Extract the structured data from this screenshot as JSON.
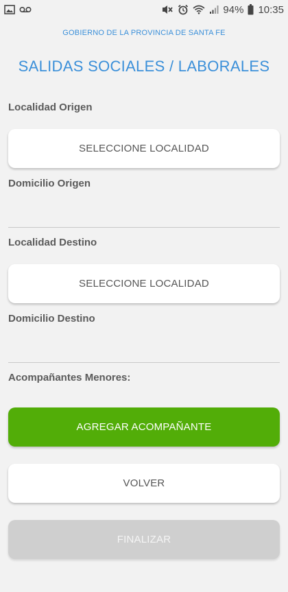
{
  "status_bar": {
    "battery_percent": "94%",
    "time": "10:35",
    "icons": [
      "image-icon",
      "voicemail-icon",
      "mute-icon",
      "alarm-icon",
      "wifi-icon",
      "signal-icon",
      "battery-icon"
    ]
  },
  "header": {
    "government": "GOBIERNO DE LA PROVINCIA DE SANTA FE",
    "title": "SALIDAS SOCIALES / LABORALES"
  },
  "form": {
    "localidad_origen_label": "Localidad Origen",
    "localidad_origen_button": "SELECCIONE LOCALIDAD",
    "domicilio_origen_label": "Domicilio Origen",
    "domicilio_origen_value": "",
    "localidad_destino_label": "Localidad Destino",
    "localidad_destino_button": "SELECCIONE LOCALIDAD",
    "domicilio_destino_label": "Domicilio Destino",
    "domicilio_destino_value": "",
    "acompanantes_label": "Acompañantes Menores:"
  },
  "actions": {
    "add_companion": "AGREGAR ACOMPAÑANTE",
    "back": "VOLVER",
    "finish": "FINALIZAR"
  },
  "colors": {
    "accent_blue": "#3a8fd9",
    "add_green": "#52ad08",
    "disabled_gray": "#cfcfcf",
    "background": "#f2f2f2"
  }
}
